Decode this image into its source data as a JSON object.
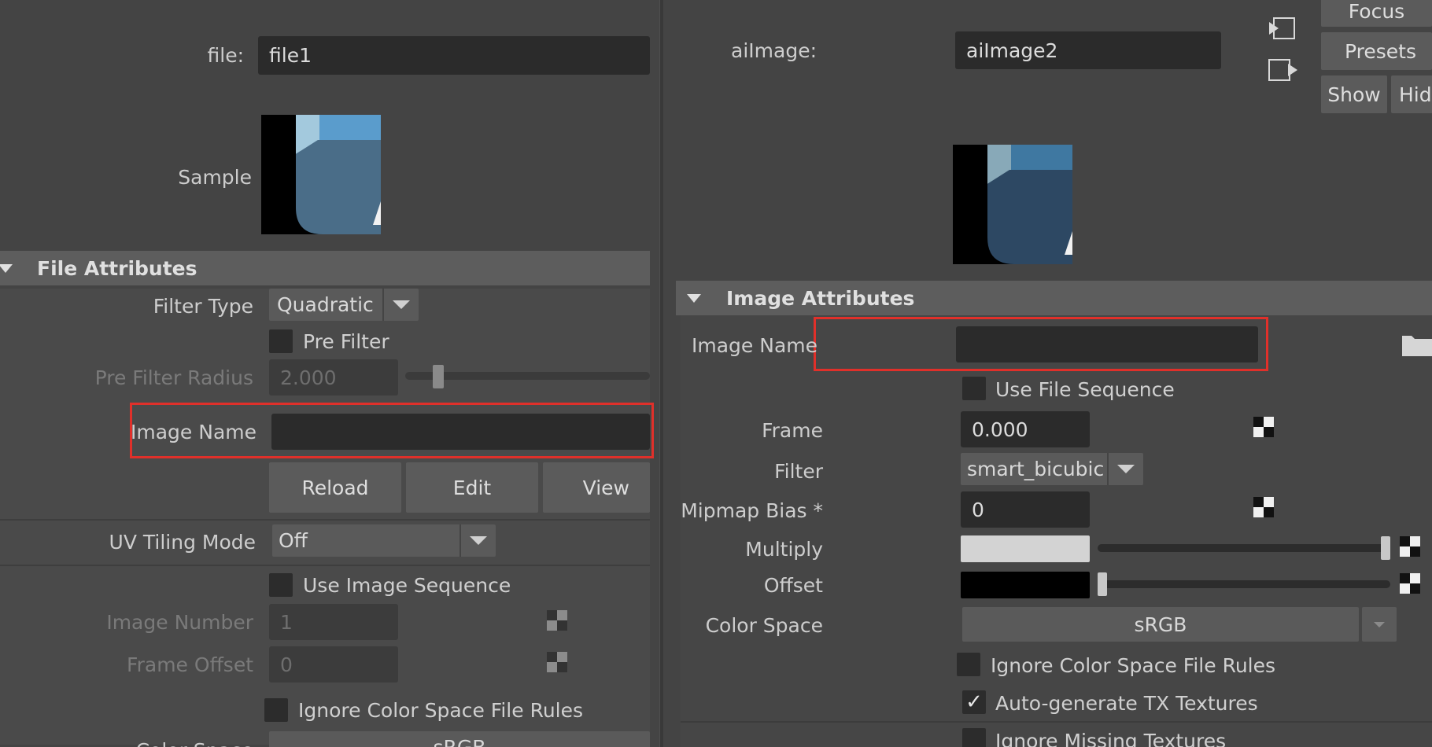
{
  "left": {
    "node_label": "file:",
    "node_name": "file1",
    "sample_label": "Sample",
    "section_title": "File Attributes",
    "filter_type_label": "Filter Type",
    "filter_type_value": "Quadratic",
    "pre_filter_label": "Pre Filter",
    "pre_filter_radius_label": "Pre Filter Radius",
    "pre_filter_radius_value": "2.000",
    "image_name_label": "Image Name",
    "image_name_value": "",
    "reload_label": "Reload",
    "edit_label": "Edit",
    "view_label": "View",
    "uv_tiling_label": "UV Tiling Mode",
    "uv_tiling_value": "Off",
    "use_image_sequence_label": "Use Image Sequence",
    "image_number_label": "Image Number",
    "image_number_value": "1",
    "frame_offset_label": "Frame Offset",
    "frame_offset_value": "0",
    "ignore_cs_label": "Ignore Color Space File Rules",
    "color_space_label": "Color Space",
    "color_space_value": "sRGB"
  },
  "right": {
    "node_label": "aiImage:",
    "node_name": "aiImage2",
    "focus_label": "Focus",
    "presets_label": "Presets",
    "show_label": "Show",
    "hide_label": "Hide",
    "section_title": "Image Attributes",
    "image_name_label": "Image Name",
    "image_name_value": "",
    "use_file_sequence_label": "Use File Sequence",
    "frame_label": "Frame",
    "frame_value": "0.000",
    "filter_label": "Filter",
    "filter_value": "smart_bicubic",
    "mipmap_label": "Mipmap Bias *",
    "mipmap_value": "0",
    "multiply_label": "Multiply",
    "multiply_level": 1.0,
    "offset_label": "Offset",
    "offset_level": 0.0,
    "color_space_label": "Color Space",
    "color_space_value": "sRGB",
    "ignore_cs_label": "Ignore Color Space File Rules",
    "auto_tx_label": "Auto-generate TX Textures",
    "auto_tx_checked": "✓",
    "ignore_missing_label": "Ignore Missing Textures"
  },
  "colors": {
    "highlight": "#e0302a",
    "panel_bg": "#444444",
    "field_bg": "#2b2b2b",
    "section_bg": "#5d5d5d"
  }
}
